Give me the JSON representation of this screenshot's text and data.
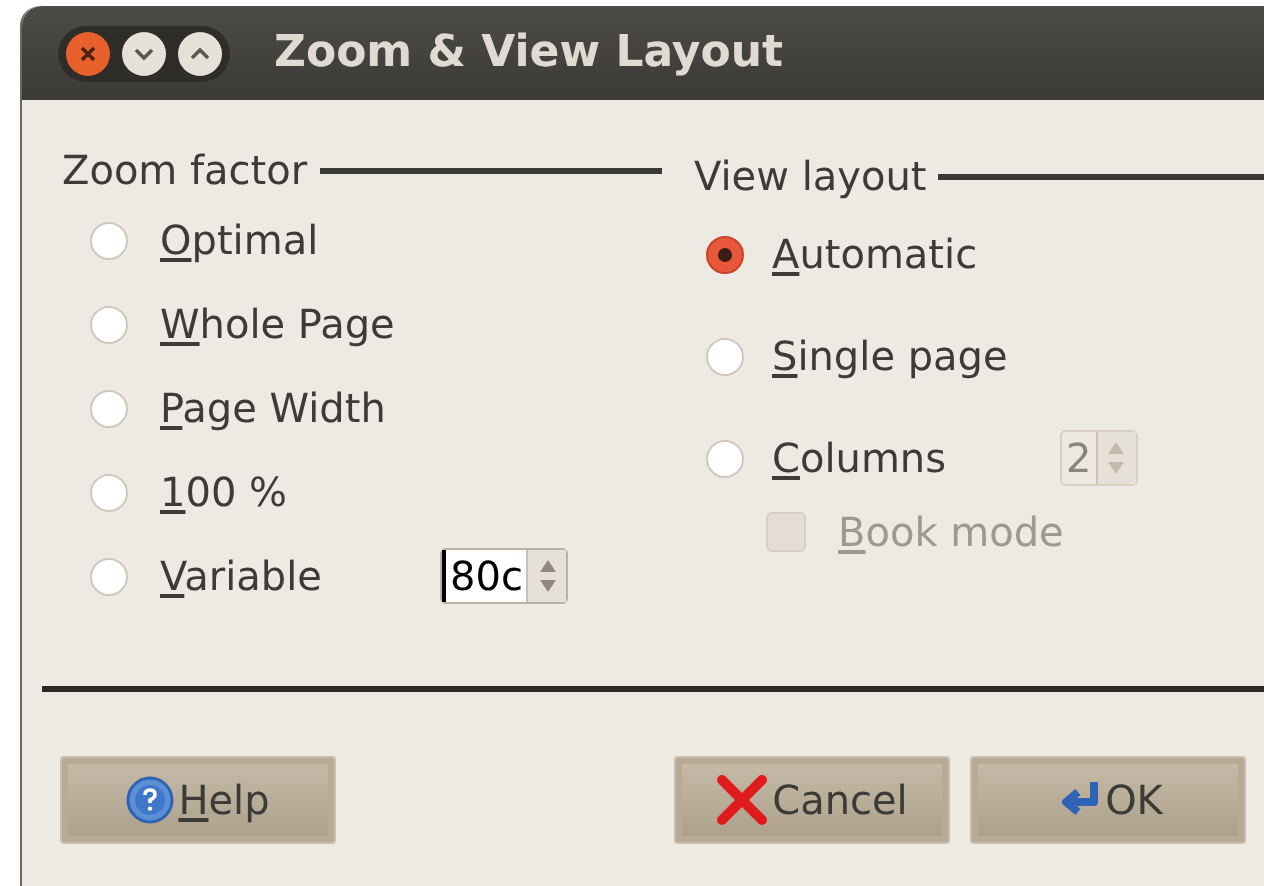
{
  "window": {
    "title": "Zoom & View Layout"
  },
  "zoom_factor": {
    "title": "Zoom factor",
    "options": [
      {
        "label": "Optimal",
        "selected": false
      },
      {
        "label": "Whole Page",
        "selected": false
      },
      {
        "label": "Page Width",
        "selected": false
      },
      {
        "label": "100 %",
        "selected": false
      },
      {
        "label": "Variable",
        "selected": false,
        "value": "80c"
      }
    ]
  },
  "view_layout": {
    "title": "View layout",
    "options": [
      {
        "label": "Automatic",
        "selected": true
      },
      {
        "label": "Single page",
        "selected": false
      },
      {
        "label": "Columns",
        "selected": false,
        "value": "2"
      }
    ],
    "book_mode": {
      "label": "Book mode",
      "checked": false,
      "disabled": true
    }
  },
  "buttons": [
    {
      "label": "Help",
      "kind": "help",
      "mnemonic": true
    },
    {
      "label": "Cancel",
      "kind": "cancel",
      "mnemonic": false
    },
    {
      "label": "OK",
      "kind": "ok",
      "mnemonic": false
    }
  ]
}
